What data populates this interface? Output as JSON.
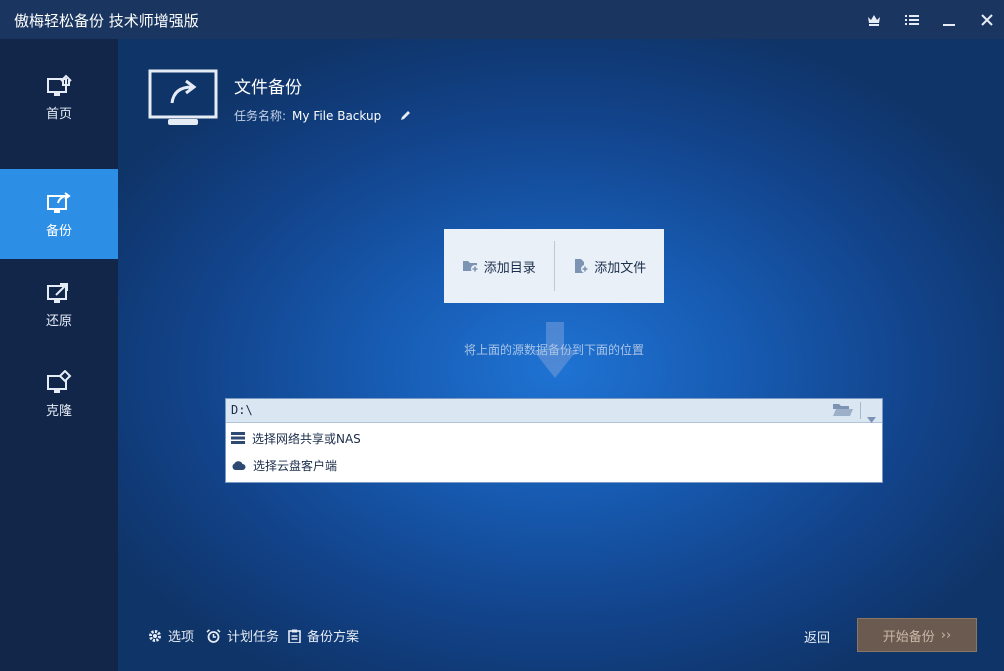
{
  "window": {
    "title": "傲梅轻松备份 技术师增强版",
    "controls": [
      "crown-icon",
      "menu-icon",
      "minimize-icon",
      "close-icon"
    ]
  },
  "sidebar": {
    "items": [
      {
        "label": "首页",
        "icon": "home-icon",
        "active": false
      },
      {
        "label": "备份",
        "icon": "backup-icon",
        "active": true
      },
      {
        "label": "还原",
        "icon": "restore-icon",
        "active": false
      },
      {
        "label": "克隆",
        "icon": "clone-icon",
        "active": false
      }
    ]
  },
  "header": {
    "title": "文件备份",
    "task_label": "任务名称:",
    "task_name": "My File Backup"
  },
  "source": {
    "add_folder": "添加目录",
    "add_file": "添加文件",
    "hint": "将上面的源数据备份到下面的位置"
  },
  "destination": {
    "value": "D:\\",
    "options": [
      {
        "label": "选择网络共享或NAS",
        "icon": "nas-icon"
      },
      {
        "label": "选择云盘客户端",
        "icon": "cloud-icon"
      }
    ]
  },
  "footer": {
    "options": "选项",
    "schedule": "计划任务",
    "scheme": "备份方案",
    "back": "返回",
    "start": "开始备份",
    "start_arrow": "››"
  },
  "colors": {
    "accent": "#2d8ee6",
    "sidebar_bg": "#12264a",
    "main_bg": "#1a5bb0",
    "start_button": "#6b5a4f"
  }
}
